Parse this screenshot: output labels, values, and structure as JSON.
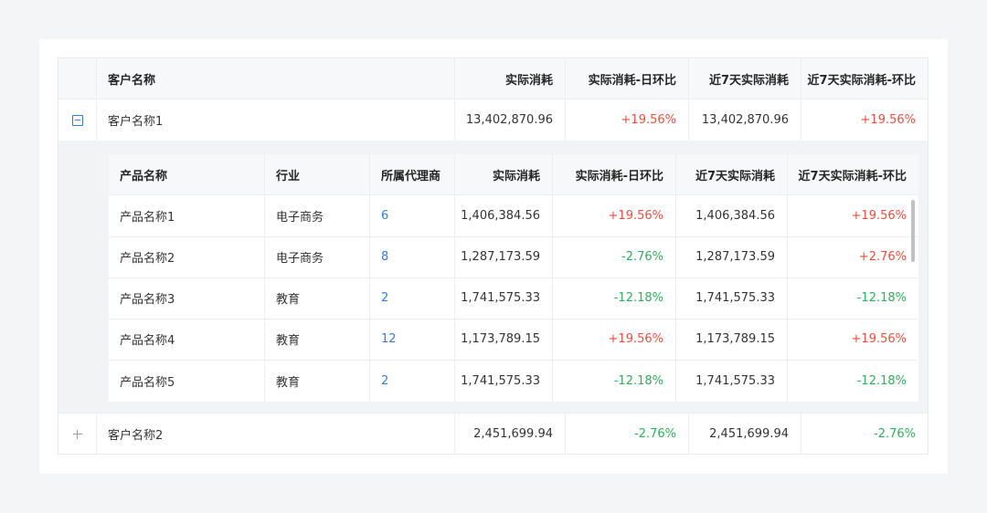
{
  "outer_table": {
    "headers": {
      "customer": "客户名称",
      "actual": "实际消耗",
      "actual_dod": "实际消耗-日环比",
      "seven_day": "近7天实际消耗",
      "seven_day_pop": "近7天实际消耗-环比"
    },
    "rows": [
      {
        "customer": "客户名称1",
        "actual": "13,402,870.96",
        "actual_dod": "+19.56%",
        "seven_day": "13,402,870.96",
        "seven_day_pop": "+19.56%",
        "expanded": true
      },
      {
        "customer": "客户名称2",
        "actual": "2,451,699.94",
        "actual_dod": "-2.76%",
        "seven_day": "2,451,699.94",
        "seven_day_pop": "-2.76%",
        "expanded": false
      }
    ]
  },
  "inner_table": {
    "headers": {
      "product": "产品名称",
      "industry": "行业",
      "agent": "所属代理商",
      "actual": "实际消耗",
      "actual_dod": "实际消耗-日环比",
      "seven_day": "近7天实际消耗",
      "seven_day_pop": "近7天实际消耗-环比"
    },
    "rows": [
      {
        "product": "产品名称1",
        "industry": "电子商务",
        "agent": "6",
        "actual": "1,406,384.56",
        "actual_dod": "+19.56%",
        "seven_day": "1,406,384.56",
        "seven_day_pop": "+19.56%"
      },
      {
        "product": "产品名称2",
        "industry": "电子商务",
        "agent": "8",
        "actual": "1,287,173.59",
        "actual_dod": "-2.76%",
        "seven_day": "1,287,173.59",
        "seven_day_pop": "+2.76%"
      },
      {
        "product": "产品名称3",
        "industry": "教育",
        "agent": "2",
        "actual": "1,741,575.33",
        "actual_dod": "-12.18%",
        "seven_day": "1,741,575.33",
        "seven_day_pop": "-12.18%"
      },
      {
        "product": "产品名称4",
        "industry": "教育",
        "agent": "12",
        "actual": "1,173,789.15",
        "actual_dod": "+19.56%",
        "seven_day": "1,173,789.15",
        "seven_day_pop": "+19.56%"
      },
      {
        "product": "产品名称5",
        "industry": "教育",
        "agent": "2",
        "actual": "1,741,575.33",
        "actual_dod": "-12.18%",
        "seven_day": "1,741,575.33",
        "seven_day_pop": "-12.18%"
      }
    ]
  },
  "colors": {
    "positive": "#f04b3e",
    "negative": "#2fae5b",
    "link": "#2f7fe0"
  },
  "icons": {
    "collapse": "minus-square-icon",
    "expand": "plus-icon"
  }
}
